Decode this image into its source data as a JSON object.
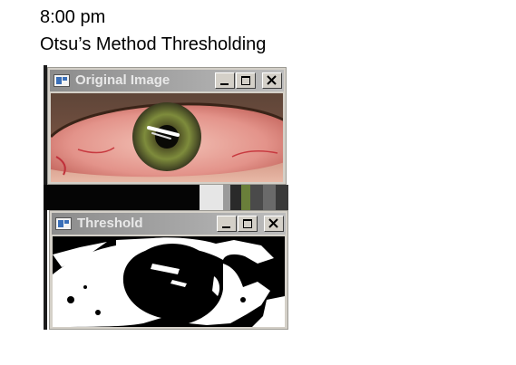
{
  "slide": {
    "time": "8:00 pm",
    "title": "Otsu’s Method Thresholding"
  },
  "windows": [
    {
      "title": "Original Image",
      "controls": [
        "minimize-icon",
        "maximize-icon",
        "close-icon"
      ]
    },
    {
      "title": "Threshold",
      "controls": [
        "minimize-icon",
        "maximize-icon",
        "close-icon"
      ]
    }
  ],
  "colors": {
    "titlebar": "#9a9a9a",
    "title_text": "#e8e8e8",
    "window_face": "#d4d0c8",
    "iris": "#7a8a3a",
    "sclera": "#e8a8a0"
  }
}
